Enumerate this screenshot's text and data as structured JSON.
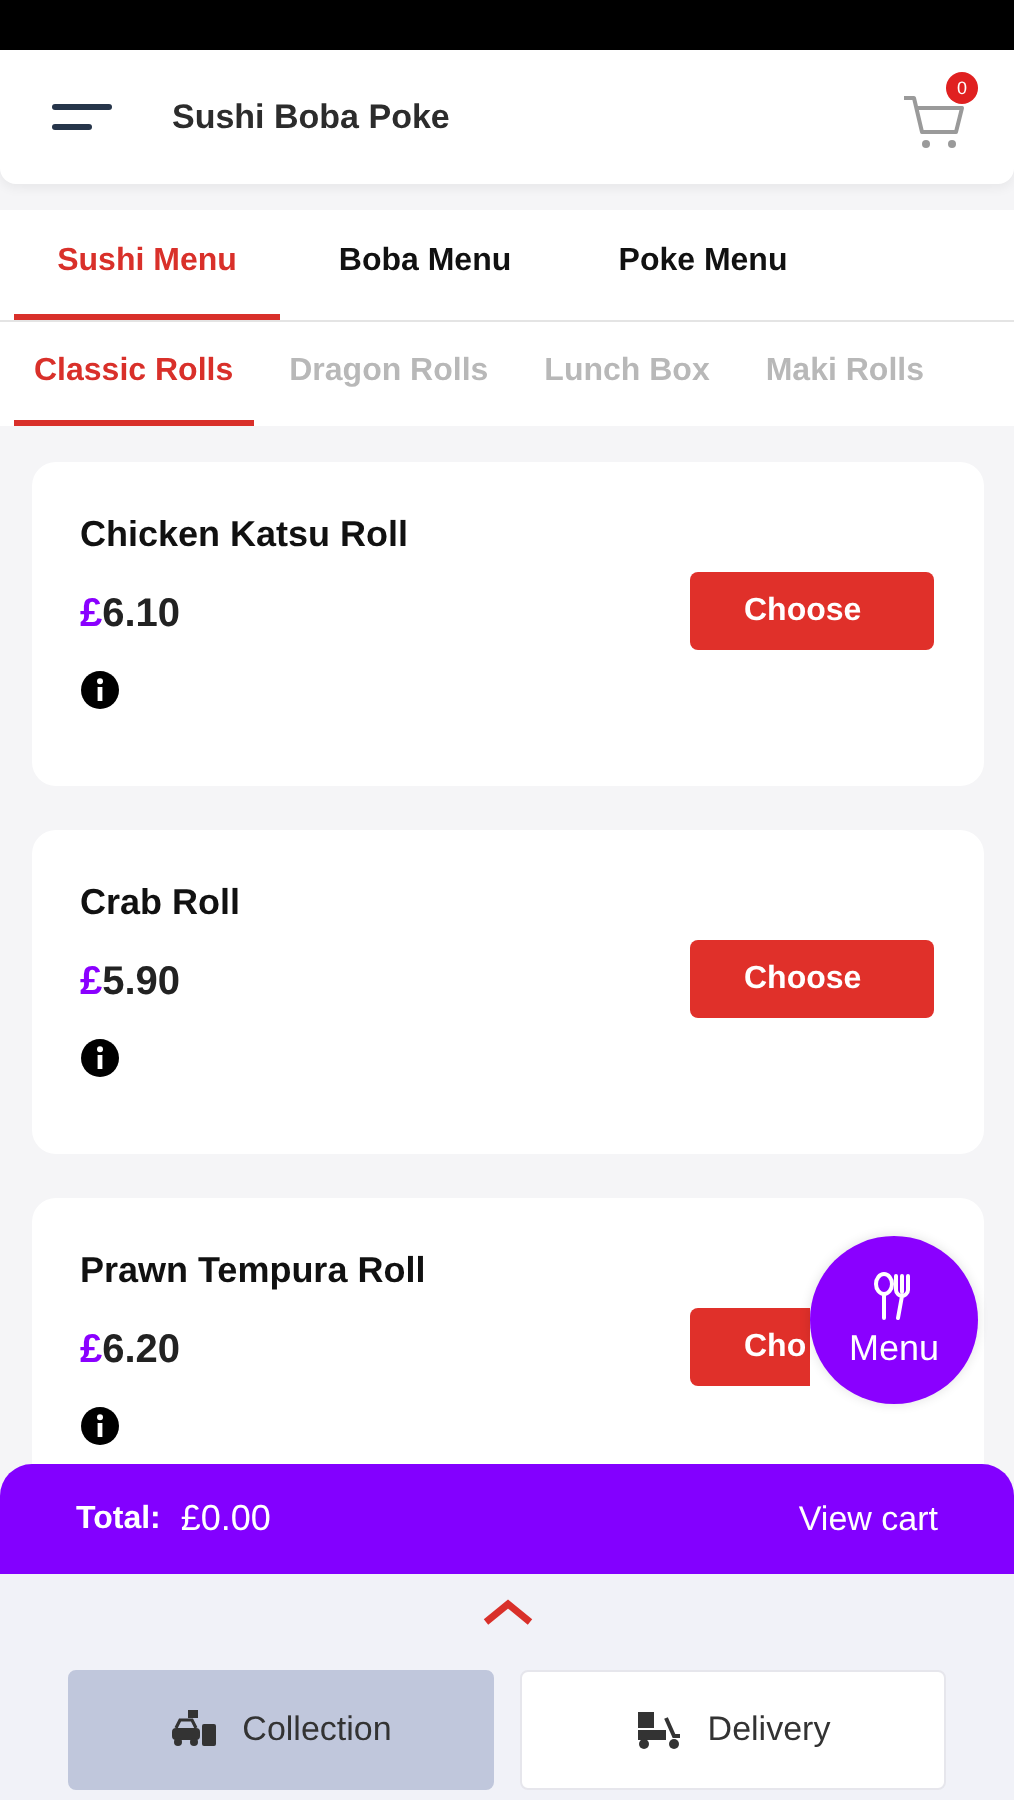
{
  "header": {
    "title": "Sushi Boba Poke",
    "cart_count": "0"
  },
  "menu_tabs": [
    {
      "label": "Sushi Menu",
      "selected": true
    },
    {
      "label": "Boba Menu",
      "selected": false
    },
    {
      "label": "Poke Menu",
      "selected": false
    }
  ],
  "category_tabs": [
    {
      "label": "Classic Rolls",
      "selected": true
    },
    {
      "label": "Dragon Rolls",
      "selected": false
    },
    {
      "label": "Lunch Box",
      "selected": false
    },
    {
      "label": "Maki Rolls",
      "selected": false
    }
  ],
  "items": [
    {
      "name": "Chicken Katsu Roll",
      "currency": "£",
      "amount": "6.10",
      "button": "Choose"
    },
    {
      "name": "Crab Roll",
      "currency": "£",
      "amount": "5.90",
      "button": "Choose"
    },
    {
      "name": "Prawn Tempura Roll",
      "currency": "£",
      "amount": "6.20",
      "button": "Cho"
    }
  ],
  "menu_button": {
    "label": "Menu"
  },
  "cart_bar": {
    "total_label": "Total:",
    "total": "£0.00",
    "action": "View cart"
  },
  "order_types": [
    {
      "label": "Collection",
      "kind": "collection",
      "selected": true
    },
    {
      "label": "Delivery",
      "kind": "delivery",
      "selected": false
    }
  ]
}
